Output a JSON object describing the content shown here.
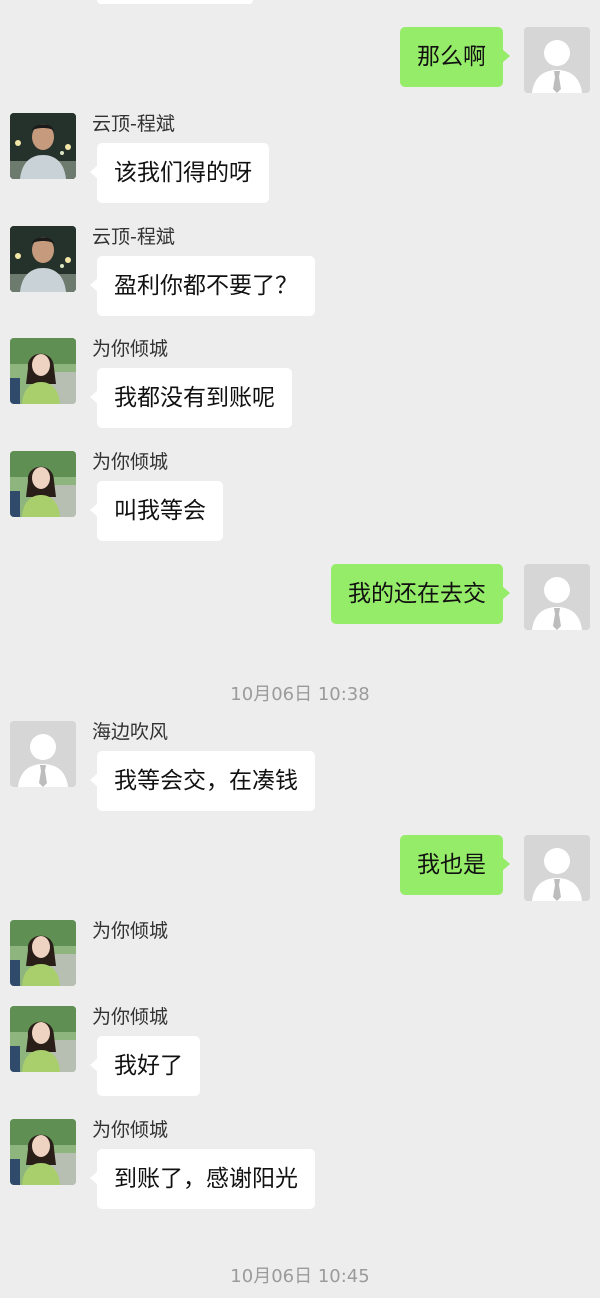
{
  "messages": [
    {
      "direction": "out",
      "text": "那么啊"
    },
    {
      "direction": "in",
      "sender": "云顶-程斌",
      "avatar": "man-photo-avatar",
      "text": "该我们得的呀"
    },
    {
      "direction": "in",
      "sender": "云顶-程斌",
      "avatar": "man-photo-avatar",
      "text": "盈利你都不要了？"
    },
    {
      "direction": "in",
      "sender": "为你倾城",
      "avatar": "woman-photo-avatar",
      "text": "我都没有到账呢"
    },
    {
      "direction": "in",
      "sender": "为你倾城",
      "avatar": "woman-photo-avatar",
      "text": "叫我等会"
    },
    {
      "direction": "out",
      "text": "我的还在去交"
    },
    {
      "type": "timestamp",
      "text": "10月06日 10:38"
    },
    {
      "direction": "in",
      "sender": "海边吹风",
      "avatar": "default-avatar",
      "text": "我等会交，在凑钱"
    },
    {
      "direction": "out",
      "text": "我也是"
    },
    {
      "direction": "in",
      "sender": "为你倾城",
      "avatar": "woman-photo-avatar",
      "text": ""
    },
    {
      "direction": "in",
      "sender": "为你倾城",
      "avatar": "woman-photo-avatar",
      "text": "我好了"
    },
    {
      "direction": "in",
      "sender": "为你倾城",
      "avatar": "woman-photo-avatar",
      "text": "到账了，感谢阳光"
    },
    {
      "type": "timestamp",
      "text": "10月06日 10:45"
    }
  ],
  "colors": {
    "background": "#ededed",
    "outgoing_bubble": "#95ec69",
    "incoming_bubble": "#ffffff",
    "timestamp_text": "#9b9b9b",
    "name_text": "#333333"
  }
}
